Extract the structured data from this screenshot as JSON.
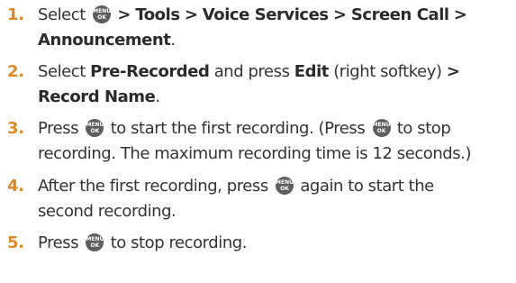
{
  "key_icon": {
    "top": "MENU",
    "bottom": "OK"
  },
  "steps": [
    {
      "number": "1.",
      "line1": {
        "select": "Select",
        "sep": ">",
        "tools": "Tools",
        "voice": "Voice Services",
        "call": "Screen Call"
      },
      "line2": {
        "announcement": "Announcement",
        "end": "."
      }
    },
    {
      "number": "2.",
      "line1": {
        "select": "Select",
        "prerec": "Pre-Recorded",
        "and_press": "and press",
        "edit": "Edit",
        "softkey": "(right softkey)",
        "sep": ">"
      },
      "line2": {
        "record_name": "Record Name",
        "end": "."
      }
    },
    {
      "number": "3.",
      "line1": {
        "press": "Press",
        "mid": "to start the first recording. (Press",
        "end": "to stop"
      },
      "line2": "recording. The maximum recording time is 12 seconds.)"
    },
    {
      "number": "4.",
      "line1": {
        "start": "After the first recording, press",
        "end": "again to start the"
      },
      "line2": "second recording."
    },
    {
      "number": "5.",
      "line1": {
        "press": "Press",
        "end": "to stop recording."
      }
    }
  ]
}
